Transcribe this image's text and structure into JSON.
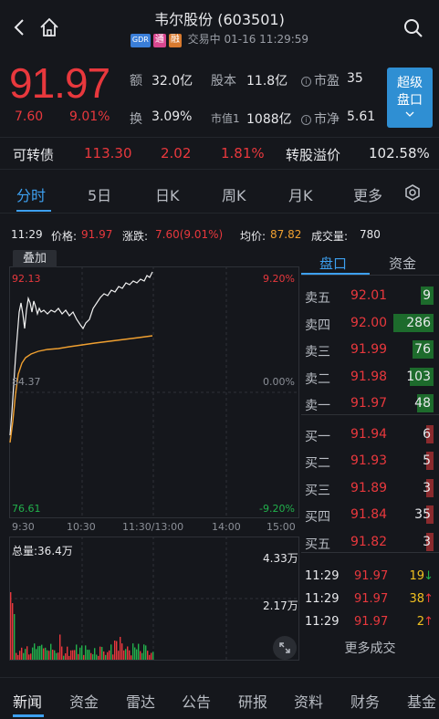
{
  "header": {
    "title": "韦尔股份 (603501)",
    "tags": [
      "GDR",
      "通",
      "融"
    ],
    "status": "交易中 01-16 11:29:59"
  },
  "quote": {
    "price": "91.97",
    "change": "7.60",
    "change_pct": "9.01%",
    "amount_label": "额",
    "amount": "32.0亿",
    "capital_label": "股本",
    "capital": "11.8亿",
    "pe_label": "市盈",
    "pe": "35",
    "turnover_label": "换",
    "turnover": "3.09%",
    "mktcap_label": "市值1",
    "mktcap": "1088亿",
    "pb_label": "市净",
    "pb": "5.61",
    "super_btn": [
      "超级",
      "盘口"
    ]
  },
  "bond": {
    "label": "可转债",
    "price": "113.30",
    "change": "2.02",
    "change_pct": "1.81%",
    "premium_label": "转股溢价",
    "premium": "102.58%"
  },
  "tabs": [
    {
      "label": "分时",
      "active": true
    },
    {
      "label": "5日"
    },
    {
      "label": "日K"
    },
    {
      "label": "周K"
    },
    {
      "label": "月K"
    },
    {
      "label": "更多"
    }
  ],
  "infobar": {
    "time": "11:29",
    "price_label": "价格:",
    "price": "91.97",
    "chg_label": "涨跌:",
    "chg": "7.60(9.01%)",
    "avg_label": "均价:",
    "avg": "87.82",
    "vol_label": "成交量:",
    "vol": "780"
  },
  "chart": {
    "overlay_btn": "叠加",
    "y_high": "92.13",
    "y_mid": "84.37",
    "y_low": "76.61",
    "pct_high": "9.20%",
    "pct_mid": "0.00%",
    "pct_low": "-9.20%",
    "x_labels": [
      "9:30",
      "10:30",
      "11:30/13:00",
      "14:00",
      "15:00"
    ],
    "vol_total": "总量:36.4万",
    "vol_high": "4.33万",
    "vol_mid": "2.17万"
  },
  "colors": {
    "up": "#e8383d",
    "down": "#22b14c",
    "accent": "#3da0f0",
    "avg_line": "#f0a030"
  },
  "book": {
    "tabs": [
      "盘口",
      "资金"
    ],
    "asks": [
      {
        "label": "卖五",
        "price": "92.01",
        "vol": "9"
      },
      {
        "label": "卖四",
        "price": "92.00",
        "vol": "286"
      },
      {
        "label": "卖三",
        "price": "91.99",
        "vol": "76"
      },
      {
        "label": "卖二",
        "price": "91.98",
        "vol": "103"
      },
      {
        "label": "卖一",
        "price": "91.97",
        "vol": "48"
      }
    ],
    "bids": [
      {
        "label": "买一",
        "price": "91.94",
        "vol": "6"
      },
      {
        "label": "买二",
        "price": "91.93",
        "vol": "5"
      },
      {
        "label": "买三",
        "price": "91.89",
        "vol": "3"
      },
      {
        "label": "买四",
        "price": "91.84",
        "vol": "35"
      },
      {
        "label": "买五",
        "price": "91.82",
        "vol": "3"
      }
    ],
    "trades": [
      {
        "time": "11:29",
        "price": "91.97",
        "vol": "19",
        "dir": "↓"
      },
      {
        "time": "11:29",
        "price": "91.97",
        "vol": "38",
        "dir": "↑"
      },
      {
        "time": "11:29",
        "price": "91.97",
        "vol": "2",
        "dir": "↑"
      }
    ],
    "more": "更多成交"
  },
  "bottomnav": [
    "新闻",
    "资金",
    "雷达",
    "公告",
    "研报",
    "资料",
    "财务",
    "基金"
  ]
}
